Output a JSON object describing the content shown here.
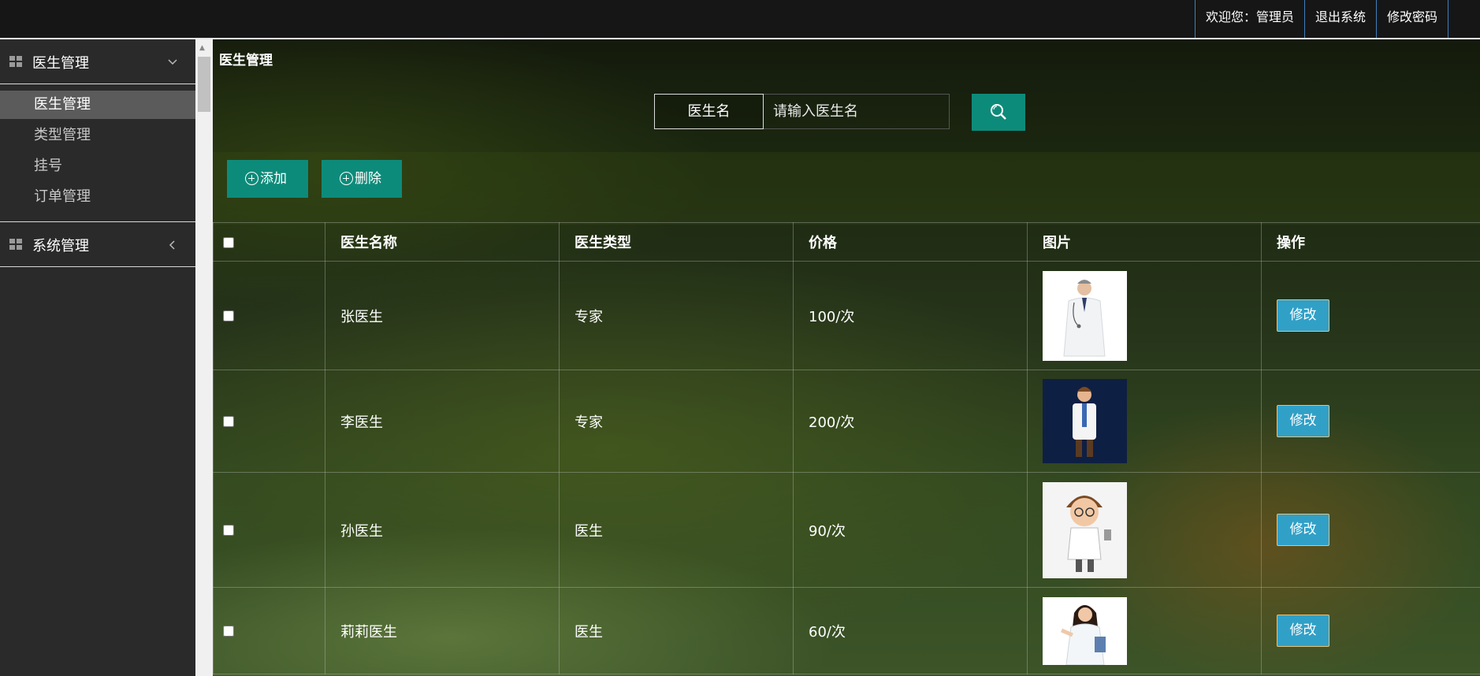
{
  "header": {
    "welcome": "欢迎您：管理员",
    "logout": "退出系统",
    "change_password": "修改密码"
  },
  "sidebar": {
    "groups": [
      {
        "title": "医生管理",
        "icon": "grid-icon",
        "arrow": "chevron-down-icon",
        "expanded": true
      },
      {
        "title": "系统管理",
        "icon": "grid-icon",
        "arrow": "chevron-left-icon",
        "expanded": false
      }
    ],
    "items": [
      {
        "label": "医生管理",
        "active": true
      },
      {
        "label": "类型管理",
        "active": false
      },
      {
        "label": "挂号",
        "active": false
      },
      {
        "label": "订单管理",
        "active": false
      }
    ]
  },
  "main": {
    "title": "医生管理",
    "search": {
      "label": "医生名",
      "value": "",
      "placeholder": "请输入医生名",
      "button_icon": "search-icon"
    },
    "toolbar": {
      "add": "添加",
      "delete": "删除"
    },
    "table": {
      "headers": [
        "医生名称",
        "医生类型",
        "价格",
        "图片",
        "操作"
      ],
      "rows": [
        {
          "name": "张医生",
          "type": "专家",
          "price": "100/次",
          "image": "doctor-photo",
          "action": "修改"
        },
        {
          "name": "李医生",
          "type": "专家",
          "price": "200/次",
          "image": "doctor-cartoon-navy",
          "action": "修改"
        },
        {
          "name": "孙医生",
          "type": "医生",
          "price": "90/次",
          "image": "doctor-cartoon-glasses",
          "action": "修改"
        },
        {
          "name": "莉莉医生",
          "type": "医生",
          "price": "60/次",
          "image": "doctor-photo-female",
          "action": "修改"
        }
      ]
    }
  },
  "colors": {
    "topbar": "#161616",
    "sidebar": "#2a2a2b",
    "accent_teal": "#0d8b7a",
    "edit_button": "#31a0c7",
    "active_menu": "#5b5b5b"
  }
}
